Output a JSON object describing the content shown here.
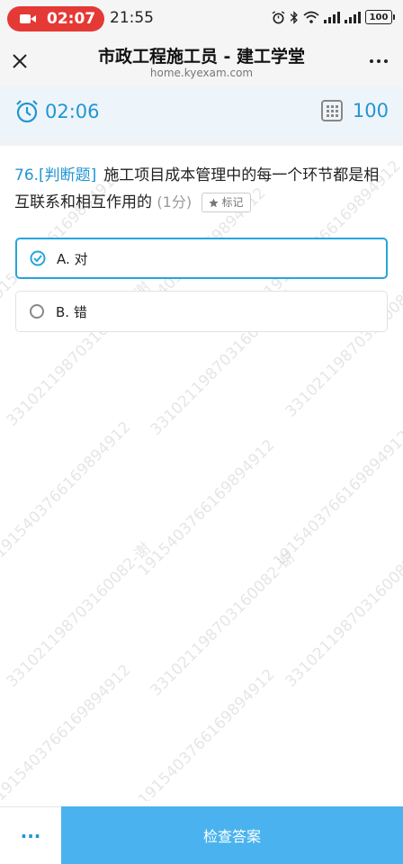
{
  "statusbar": {
    "recording_time": "02:07",
    "clock": "21:55",
    "battery": "100"
  },
  "nav": {
    "title": "市政工程施工员 - 建工学堂",
    "url": "home.kyexam.com"
  },
  "timer": {
    "remaining": "02:06",
    "question_count": "100"
  },
  "question": {
    "number": "76.",
    "type": "[判断题]",
    "text": "施工项目成本管理中的每一个环节都是相互联系和相互作用的",
    "score": "(1分)",
    "mark_label": "标记"
  },
  "options": [
    {
      "label": "A. 对",
      "selected": true
    },
    {
      "label": "B. 错",
      "selected": false
    }
  ],
  "watermark": {
    "line_a": "19154037661698949​12",
    "line_b": "331021198703160082-谢"
  },
  "bottom": {
    "more_label": "···",
    "check_label": "检查答案"
  },
  "colors": {
    "accent": "#2196d3",
    "button": "#4ab3ef",
    "record": "#e53935"
  }
}
